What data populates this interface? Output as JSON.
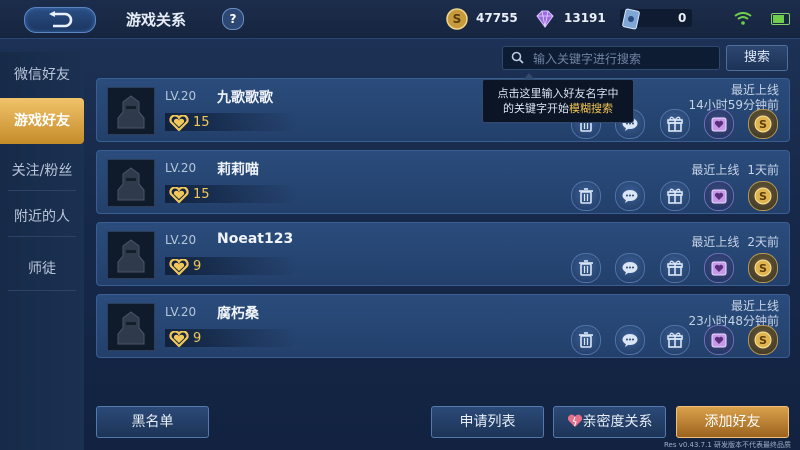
{
  "header": {
    "title": "游戏关系",
    "help_label": "?",
    "back_icon": "back-arrow-icon"
  },
  "currency": {
    "gold": "47755",
    "diamond": "13191",
    "coupon": "0"
  },
  "status": {
    "wifi_icon": "wifi-icon",
    "battery_icon": "battery-icon",
    "battery_level": 0.85
  },
  "sidebar": {
    "items": [
      {
        "label": "微信好友",
        "active": false
      },
      {
        "label": "游戏好友",
        "active": true
      },
      {
        "label": "关注/粉丝",
        "active": false
      },
      {
        "label": "附近的人",
        "active": false
      },
      {
        "label": "师徒",
        "active": false
      }
    ]
  },
  "search": {
    "placeholder": "输入关键字进行搜索",
    "value": "",
    "button_label": "搜索"
  },
  "tooltip": {
    "line1": "点击这里输入好友名字中",
    "line2_prefix": "的关键字开始",
    "line2_highlight": "模糊搜索"
  },
  "friends": [
    {
      "level": "LV.20",
      "name": "九歌歌歌",
      "intimacy": "15",
      "last_online_label": "最近上线",
      "last_online_time": "14小时59分钟前"
    },
    {
      "level": "LV.20",
      "name": "莉莉喵",
      "intimacy": "15",
      "last_online_label": "最近上线",
      "last_online_time": "1天前"
    },
    {
      "level": "LV.20",
      "name": "Noeat123",
      "intimacy": "9",
      "last_online_label": "最近上线",
      "last_online_time": "2天前"
    },
    {
      "level": "LV.20",
      "name": "腐朽桑",
      "intimacy": "9",
      "last_online_label": "最近上线",
      "last_online_time": "23小时48分钟前"
    }
  ],
  "actions": {
    "icons": [
      "trash-icon",
      "chat-icon",
      "gift-icon",
      "intimacy-gift-icon",
      "coin-gift-icon"
    ]
  },
  "footer": {
    "blacklist_label": "黑名单",
    "requests_label": "申请列表",
    "intimacy_label": "亲密度关系",
    "add_friend_label": "添加好友",
    "version": "Res v0.43.7.1 研发版本不代表最终品质"
  },
  "colors": {
    "accent_gold": "#d9a14a",
    "highlight_yellow": "#f2c44f",
    "panel_blue": "#23406b"
  }
}
